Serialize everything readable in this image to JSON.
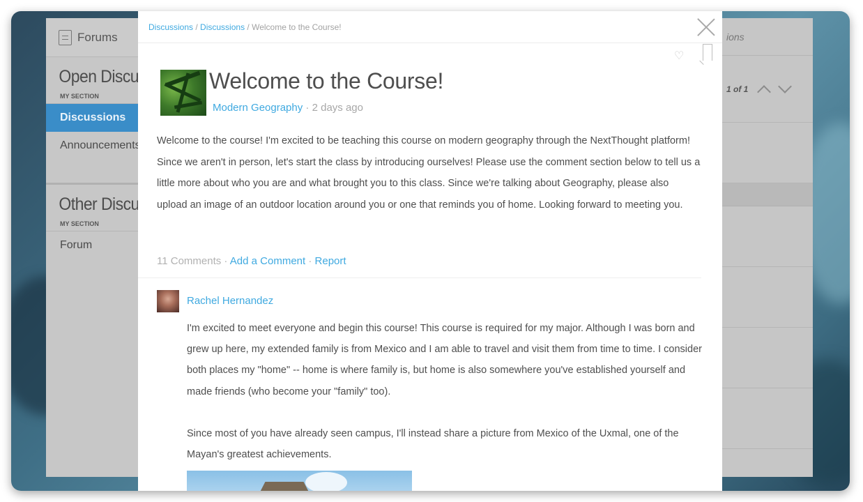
{
  "sidebar": {
    "header": "Forums",
    "groups": [
      {
        "title": "Open Discussions",
        "section_label": "MY SECTION",
        "items": [
          {
            "label": "Discussions"
          },
          {
            "label": "Announcements"
          }
        ]
      },
      {
        "title": "Other Discussions",
        "section_label": "MY SECTION",
        "items": [
          {
            "label": "Forum"
          }
        ]
      }
    ]
  },
  "right_panel": {
    "header": "ions",
    "pager": "1 of 1"
  },
  "modal": {
    "breadcrumb": {
      "part1": "Discussions",
      "sep1": " / ",
      "part2": "Discussions",
      "sep2": " / ",
      "current": "Welcome to the Course!"
    },
    "title": "Welcome to the Course!",
    "meta": {
      "course": "Modern Geography",
      "sep": " · ",
      "time": "2 days ago"
    },
    "body": "Welcome to the course! I'm excited to be teaching this course on modern geography through the NextThought platform! Since we aren't in person, let's start the class by introducing ourselves! Please use the comment section below to tell us a little more about who you are and what brought you to this class. Since we're talking about Geography, please also upload an image of an outdoor location around you or one that reminds you of home. Looking forward to meeting you.",
    "actions": {
      "comments": "11 Comments",
      "sep": " · ",
      "add_comment": "Add a Comment",
      "report": "Report"
    },
    "comment": {
      "author": "Rachel Hernandez",
      "paragraph1": "I'm excited to meet everyone and begin this course! This course is required for my major. Although I was born and grew up here, my extended family is from Mexico and I am able to travel and visit them from time to time. I consider both places my \"home\" -- home is where family is, but home is also somewhere you've established yourself and made friends (who become your \"family\" too).",
      "paragraph2": "Since most of you have already seen campus, I'll instead share a picture from Mexico of the Uxmal, one of the Mayan's greatest achievements."
    }
  },
  "colors": {
    "accent": "#3fa9e0",
    "active_item": "#3a8dc8",
    "text": "#4e4e4e",
    "muted": "#a7a7a7"
  }
}
